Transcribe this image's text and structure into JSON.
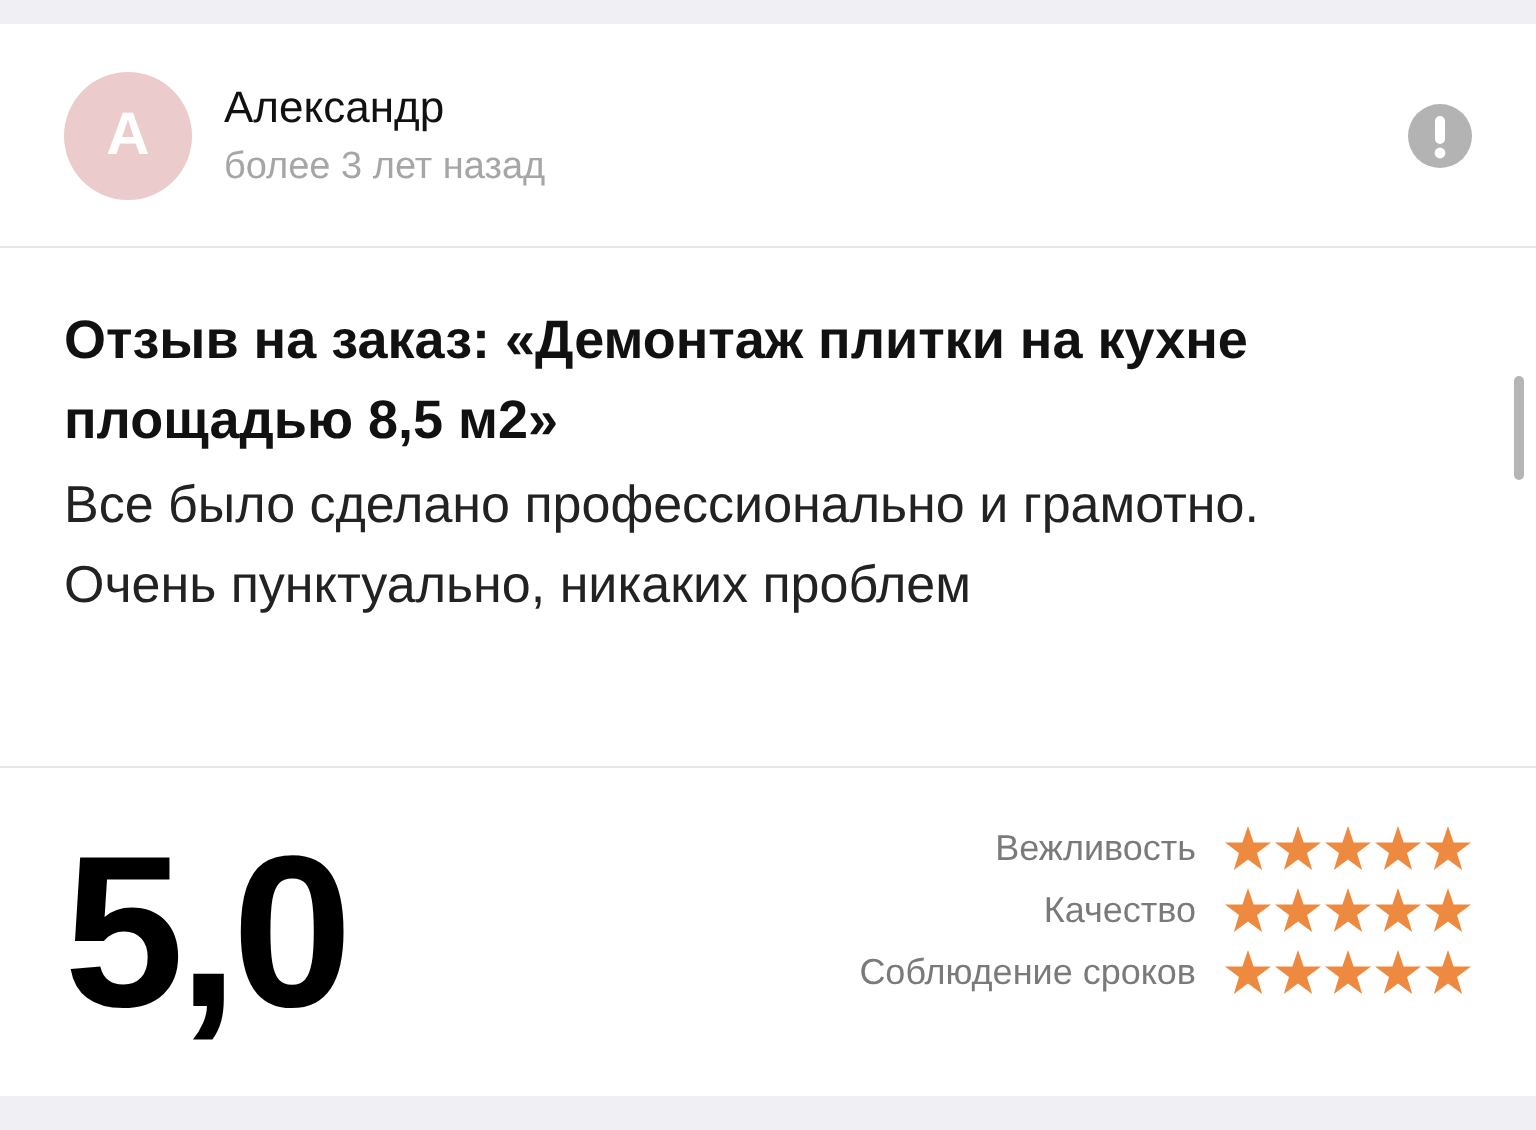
{
  "author": {
    "initial": "А",
    "name": "Александр",
    "time": "более 3 лет назад"
  },
  "review": {
    "title": "Отзыв на заказ: «Демонтаж плитки на кухне площадью 8,5 м2»",
    "text": "Все было сделано профессионально и грамотно. Очень пунктуально, никаких проблем"
  },
  "score": "5,0",
  "criteria": [
    {
      "label": "Вежливость",
      "stars": 5
    },
    {
      "label": "Качество",
      "stars": 5
    },
    {
      "label": "Соблюдение сроков",
      "stars": 5
    }
  ]
}
